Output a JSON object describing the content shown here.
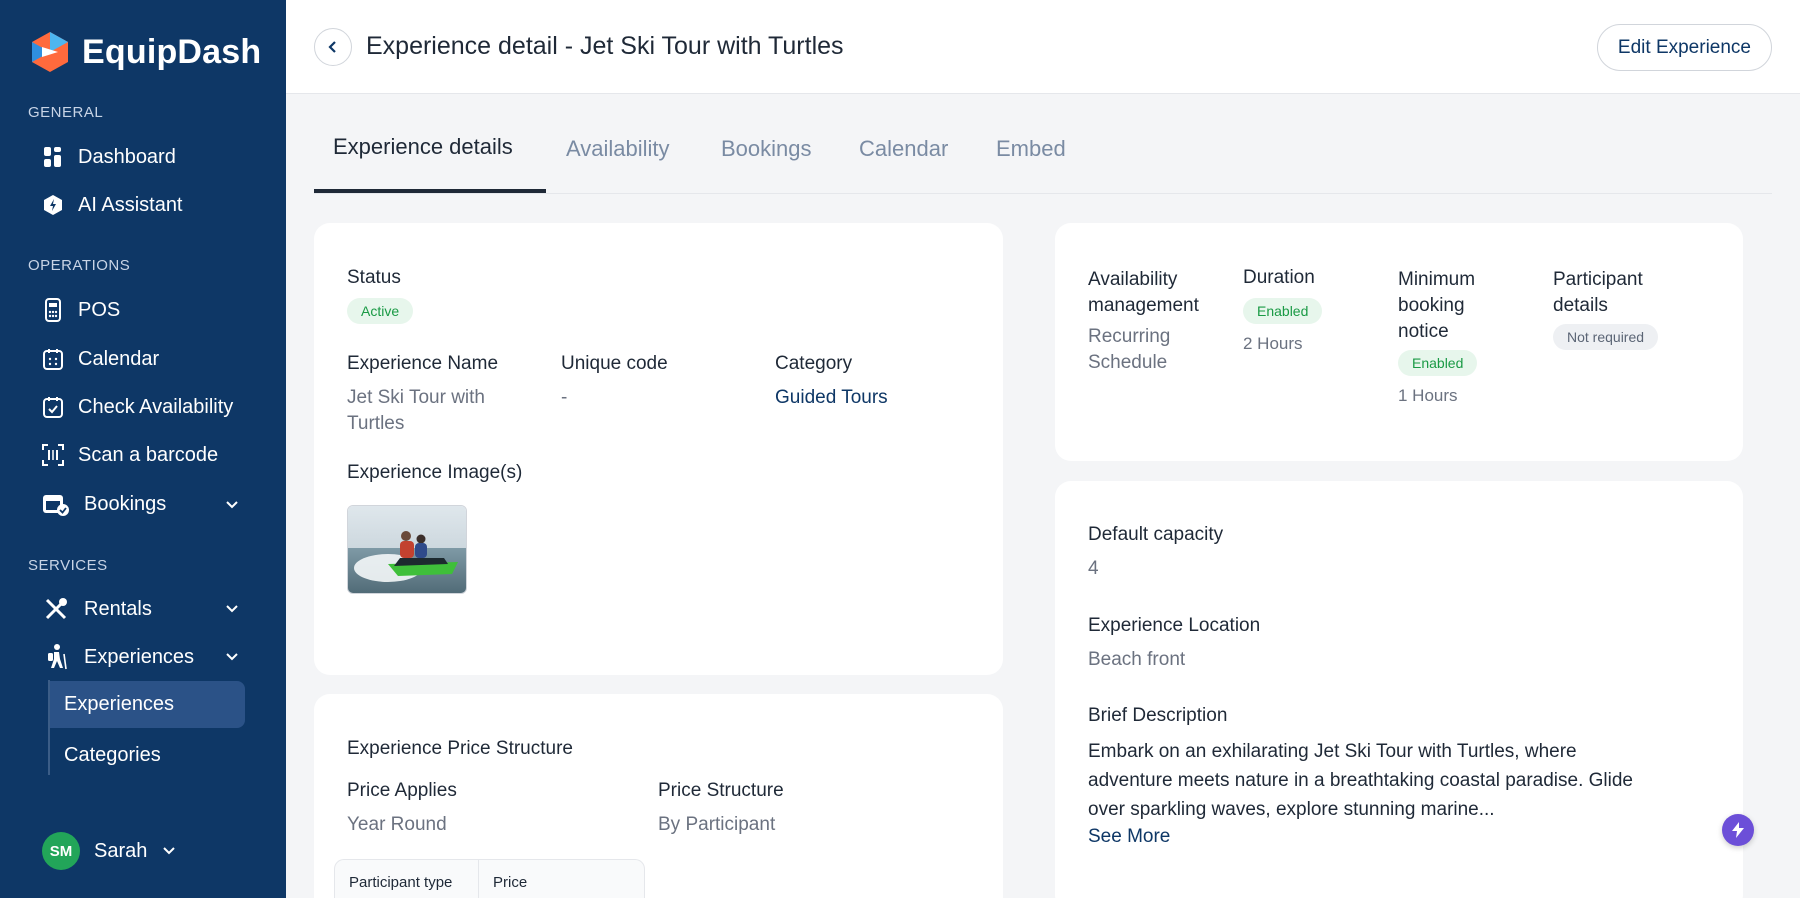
{
  "app": {
    "name": "EquipDash"
  },
  "sidebar": {
    "sections": {
      "general": "GENERAL",
      "operations": "OPERATIONS",
      "services": "SERVICES"
    },
    "items": {
      "dashboard": "Dashboard",
      "ai_assistant": "AI Assistant",
      "pos": "POS",
      "calendar": "Calendar",
      "check_availability": "Check Availability",
      "scan_barcode": "Scan a barcode",
      "bookings": "Bookings",
      "rentals": "Rentals",
      "experiences": "Experiences"
    },
    "sub_items": {
      "experiences": "Experiences",
      "categories": "Categories"
    },
    "user": {
      "initials": "SM",
      "name": "Sarah"
    }
  },
  "header": {
    "title": "Experience detail - Jet Ski Tour with Turtles",
    "edit_label": "Edit Experience"
  },
  "tabs": [
    "Experience details",
    "Availability",
    "Bookings",
    "Calendar",
    "Embed"
  ],
  "details": {
    "status_label": "Status",
    "status_value": "Active",
    "name_label": "Experience Name",
    "name_value_line1": "Jet Ski Tour with",
    "name_value_line2": "Turtles",
    "code_label": "Unique code",
    "code_value": "-",
    "category_label": "Category",
    "category_value": "Guided Tours",
    "images_label": "Experience Image(s)"
  },
  "price": {
    "title": "Experience Price Structure",
    "applies_label": "Price Applies",
    "applies_value": "Year Round",
    "structure_label": "Price Structure",
    "structure_value": "By Participant",
    "columns": [
      "Participant type",
      "Price"
    ]
  },
  "availability": {
    "mgmt_label_line1": "Availability",
    "mgmt_label_line2": "management",
    "mgmt_value_line1": "Recurring",
    "mgmt_value_line2": "Schedule",
    "duration_label": "Duration",
    "duration_badge": "Enabled",
    "duration_value": "2 Hours",
    "notice_label_line1": "Minimum",
    "notice_label_line2": "booking",
    "notice_label_line3": "notice",
    "notice_badge": "Enabled",
    "notice_value": "1 Hours",
    "participant_label_line1": "Participant",
    "participant_label_line2": "details",
    "participant_badge": "Not required"
  },
  "info": {
    "capacity_label": "Default capacity",
    "capacity_value": "4",
    "location_label": "Experience Location",
    "location_value": "Beach front",
    "desc_label": "Brief Description",
    "desc_line1": "Embark on an exhilarating Jet Ski Tour with Turtles, where",
    "desc_line2": "adventure meets nature in a breathtaking coastal paradise. Glide",
    "desc_line3": "over sparkling waves, explore stunning marine...",
    "see_more": "See More"
  },
  "colors": {
    "sidebar_bg": "#0e3766",
    "accent": "#0e3766",
    "success": "#1a9a45",
    "fab": "#6c4fd8"
  }
}
